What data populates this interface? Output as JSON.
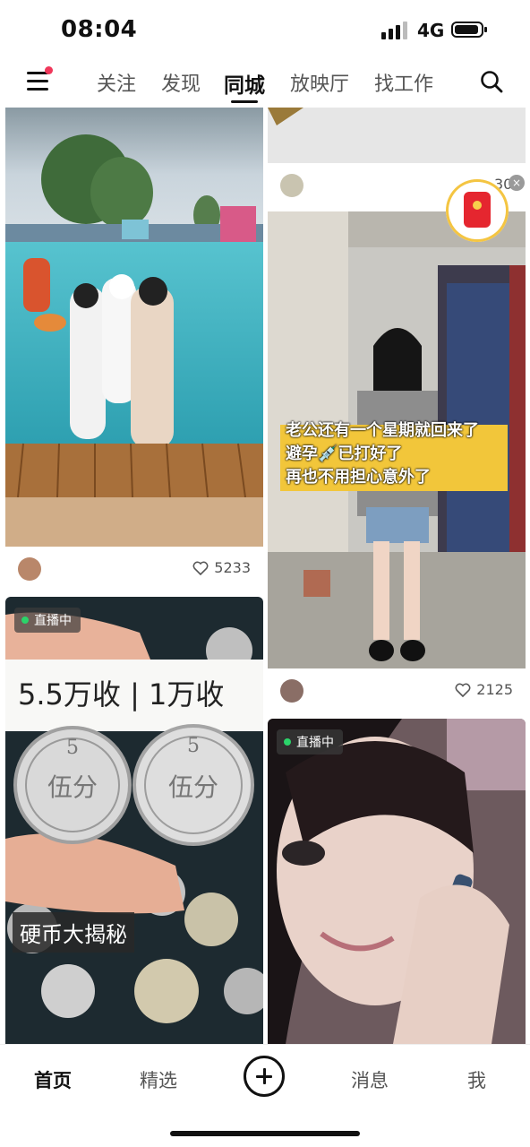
{
  "status_bar": {
    "time": "08:04",
    "network": "4G"
  },
  "top_nav": {
    "tabs": [
      {
        "label": "关注",
        "active": false
      },
      {
        "label": "发现",
        "active": false
      },
      {
        "label": "同城",
        "active": true
      },
      {
        "label": "放映厅",
        "active": false
      },
      {
        "label": "找工作",
        "active": false
      }
    ]
  },
  "feed": {
    "cards": [
      {
        "id": "waterpark",
        "likes": "5233"
      },
      {
        "id": "coins",
        "live_badge": "直播中",
        "caption": "硬币大揭秘",
        "handwritten": "5.5万收   1万收"
      },
      {
        "id": "top-right",
        "partial_count": "30"
      },
      {
        "id": "girl-corridor",
        "overlay_lines": [
          "老公还有一个星期就回来了",
          "避孕💉已打好了",
          "再也不用担心意外了"
        ],
        "likes": "2125"
      },
      {
        "id": "girl-phone",
        "live_badge": "直播中"
      }
    ]
  },
  "bottom_tabbar": {
    "items": [
      {
        "label": "首页",
        "active": true
      },
      {
        "label": "精选",
        "active": false
      },
      {
        "label": "消息",
        "active": false
      },
      {
        "label": "我",
        "active": false
      }
    ]
  },
  "colors": {
    "accent_red": "#f0375a",
    "live_green": "#2bd46a",
    "caption_yellow": "#f2c63a"
  }
}
